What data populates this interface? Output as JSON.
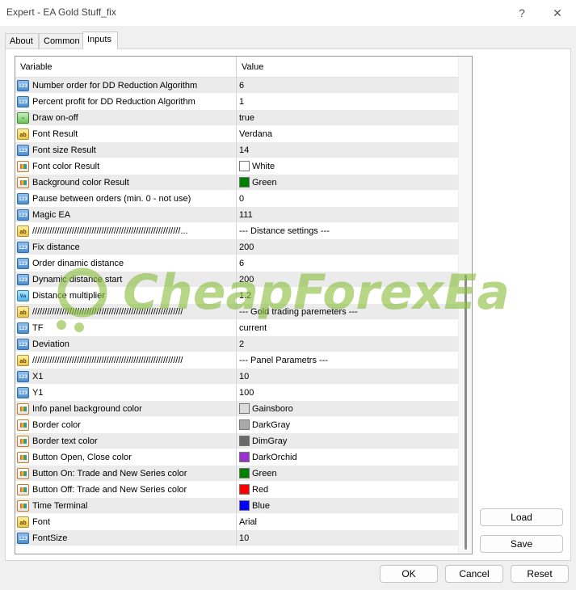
{
  "window": {
    "title": "Expert - EA Gold Stuff_fix",
    "help_glyph": "?",
    "close_glyph": "✕"
  },
  "tabs": [
    {
      "label": "About",
      "active": false
    },
    {
      "label": "Common",
      "active": false
    },
    {
      "label": "Inputs",
      "active": true
    }
  ],
  "grid": {
    "header_variable": "Variable",
    "header_value": "Value",
    "rows": [
      {
        "icon": "num",
        "name": "Number order for DD Reduction Algorithm",
        "value": "6"
      },
      {
        "icon": "num",
        "name": "Percent profit for DD Reduction Algorithm",
        "value": "1"
      },
      {
        "icon": "bool",
        "name": "Draw on-off",
        "value": "true"
      },
      {
        "icon": "str",
        "name": "Font Result",
        "value": "Verdana"
      },
      {
        "icon": "num",
        "name": "Font size Result",
        "value": "14"
      },
      {
        "icon": "color",
        "name": "Font color Result",
        "value": "White",
        "swatch": "#ffffff"
      },
      {
        "icon": "color",
        "name": "Background color Result",
        "value": "Green",
        "swatch": "#008000"
      },
      {
        "icon": "num",
        "name": "Pause between orders (min. 0 - not use)",
        "value": "0"
      },
      {
        "icon": "num",
        "name": "Magic EA",
        "value": "111"
      },
      {
        "icon": "str",
        "name": "////////////////////////////////////////////////////////////...",
        "value": "--- Distance settings ---"
      },
      {
        "icon": "num",
        "name": "Fix distance",
        "value": "200"
      },
      {
        "icon": "num",
        "name": "Order dinamic distance",
        "value": "6"
      },
      {
        "icon": "num",
        "name": "Dynamic distance start",
        "value": "200"
      },
      {
        "icon": "dbl",
        "name": "Distance multiplier",
        "value": "1.2"
      },
      {
        "icon": "str",
        "name": "/////////////////////////////////////////////////////////////",
        "value": "--- Gold trading paremeters ---"
      },
      {
        "icon": "num",
        "name": "TF",
        "value": "current"
      },
      {
        "icon": "num",
        "name": "Deviation",
        "value": "2"
      },
      {
        "icon": "str",
        "name": "/////////////////////////////////////////////////////////////",
        "value": "--- Panel Parametrs ---"
      },
      {
        "icon": "num",
        "name": "X1",
        "value": "10"
      },
      {
        "icon": "num",
        "name": "Y1",
        "value": "100"
      },
      {
        "icon": "color",
        "name": "Info panel background color",
        "value": "Gainsboro",
        "swatch": "#dcdcdc"
      },
      {
        "icon": "color",
        "name": "Border color",
        "value": "DarkGray",
        "swatch": "#a9a9a9"
      },
      {
        "icon": "color",
        "name": "Border text color",
        "value": "DimGray",
        "swatch": "#696969"
      },
      {
        "icon": "color",
        "name": "Button Open, Close color",
        "value": "DarkOrchid",
        "swatch": "#9932cc"
      },
      {
        "icon": "color",
        "name": "Button On: Trade and New Series color",
        "value": "Green",
        "swatch": "#008000"
      },
      {
        "icon": "color",
        "name": "Button Off: Trade and New Series color",
        "value": "Red",
        "swatch": "#ff0000"
      },
      {
        "icon": "color",
        "name": "Time Terminal",
        "value": "Blue",
        "swatch": "#0000ff"
      },
      {
        "icon": "str",
        "name": "Font",
        "value": "Arial"
      },
      {
        "icon": "num",
        "name": "FontSize",
        "value": "10"
      }
    ]
  },
  "icon_glyphs": {
    "num": "123",
    "str": "ab",
    "bool": "~",
    "color": "",
    "dbl": "Va"
  },
  "side_buttons": {
    "load": "Load",
    "save": "Save"
  },
  "footer_buttons": {
    "ok": "OK",
    "cancel": "Cancel",
    "reset": "Reset"
  },
  "watermark": {
    "text": "CheapForexEa",
    "color": "#8cbf3f"
  }
}
